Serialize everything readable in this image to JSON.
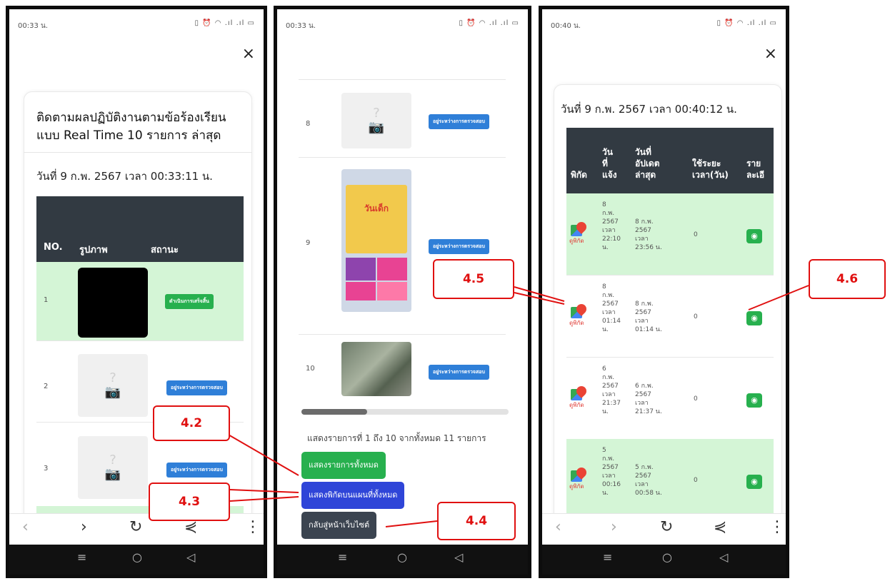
{
  "phone1": {
    "status_time": "00:33 น.",
    "status_icons": "▯ ⏰ ◠ .ıl .ıl ▭",
    "close": "×",
    "title_line1": "ติดตามผลปฏิบัติงานตามข้อร้องเรียน",
    "title_line2": "แบบ Real Time 10 รายการ ล่าสุด",
    "date": "วันที่ 9 ก.พ. 2567 เวลา 00:33:11 น.",
    "table_headers": {
      "no": "NO.",
      "photo": "รูปภาพ",
      "status": "สถานะ"
    },
    "rows": [
      {
        "no": "1",
        "status": "ดำเนินการเสร็จสิ้น"
      },
      {
        "no": "2",
        "status": "อยู่ระหว่างการตรวจสอบ"
      },
      {
        "no": "3",
        "status": "อยู่ระหว่างการตรวจสอบ"
      }
    ]
  },
  "phone2": {
    "status_time": "00:33 น.",
    "status_icons": "▯ ⏰ ◠ .ıl .ıl ▭",
    "rows": [
      {
        "no": "8",
        "status": "อยู่ระหว่างการตรวจสอบ"
      },
      {
        "no": "9",
        "status": "อยู่ระหว่างการตรวจสอบ",
        "poster_text": "วันเด็ก"
      },
      {
        "no": "10",
        "status": "อยู่ระหว่างการตรวจสอบ"
      }
    ],
    "summary": "แสดงรายการที่ 1 ถึง 10 จากทั้งหมด 11 รายการ",
    "btn_show_all": "แสดงรายการทั้งหมด",
    "btn_show_map": "แสดงพิกัดบนแผนที่ทั้งหมด",
    "btn_back": "กลับสู่หน้าเว็บไซต์"
  },
  "phone3": {
    "status_time": "00:40 น.",
    "status_icons": "▯ ⏰ ◠ .ıl .ıl ▭",
    "close": "×",
    "date": "วันที่ 9 ก.พ. 2567 เวลา 00:40:12 น.",
    "headers": {
      "coord": "พิกัด",
      "notified": "วัน\nที่\nแจ้ง",
      "updated": "วันที่\nอัปเดต\nล่าสุด",
      "duration": "ใช้ระยะ\nเวลา(วัน)",
      "detail": "ราย\nละเอี"
    },
    "map_label": "ดูพิกัด",
    "rows": [
      {
        "notified": "8\nก.พ.\n2567\nเวลา\n22:10\nน.",
        "updated": "8 ก.พ.\n2567\nเวลา\n23:56 น.",
        "duration": "0"
      },
      {
        "notified": "8\nก.พ.\n2567\nเวลา\n01:14\nน.",
        "updated": "8 ก.พ.\n2567\nเวลา\n01:14 น.",
        "duration": "0"
      },
      {
        "notified": "6\nก.พ.\n2567\nเวลา\n21:37\nน.",
        "updated": "6 ก.พ.\n2567\nเวลา\n21:37 น.",
        "duration": "0"
      },
      {
        "notified": "5\nก.พ.\n2567\nเวลา\n00:16\nน.",
        "updated": "5 ก.พ.\n2567\nเวลา\n00:58 น.",
        "duration": "0"
      }
    ]
  },
  "nav": {
    "back": "‹",
    "forward": "›",
    "reload": "↻",
    "share": "⋞",
    "menu": "⋮"
  },
  "sys": {
    "recents": "≡",
    "home": "○",
    "back": "◁"
  },
  "callouts": {
    "c42": "4.2",
    "c43": "4.3",
    "c44": "4.4",
    "c45": "4.5",
    "c46": "4.6"
  },
  "colors": {
    "header_bg": "#323a42",
    "row_green": "#d4f5d6",
    "btn_green": "#27b04e",
    "btn_blue": "#2f45d8",
    "btn_dark": "#3b4450",
    "callout_red": "#e01010"
  }
}
